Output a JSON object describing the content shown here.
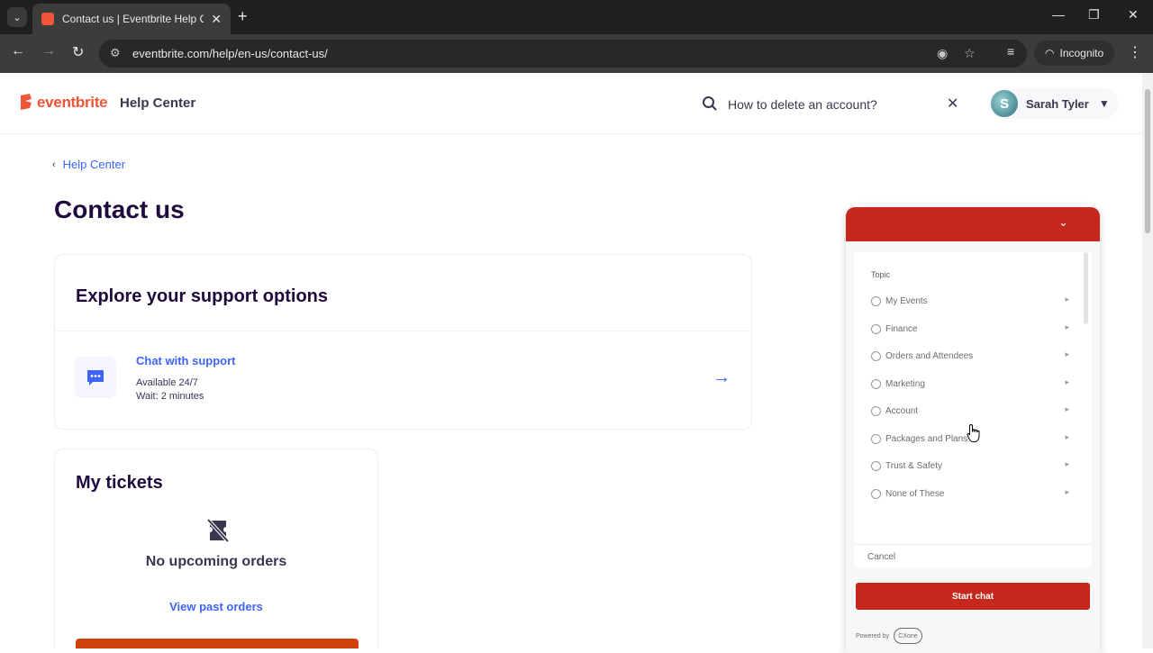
{
  "browser": {
    "tab_title": "Contact us | Eventbrite Help Ce",
    "url": "eventbrite.com/help/en-us/contact-us/",
    "incognito_label": "Incognito"
  },
  "header": {
    "logo_text": "eventbrite",
    "section_title": "Help Center",
    "search_value": "How to delete an account?",
    "user_name": "Sarah Tyler",
    "avatar_initial": "S"
  },
  "breadcrumb": {
    "label": "Help Center"
  },
  "page_title": "Contact us",
  "support": {
    "title": "Explore your support options",
    "chat_link": "Chat with support",
    "availability": "Available 24/7",
    "wait": "Wait: 2 minutes"
  },
  "tickets": {
    "title": "My tickets",
    "empty_text": "No upcoming orders",
    "view_past": "View past orders"
  },
  "chat_widget": {
    "topic_label": "Topic",
    "topics": [
      "My Events",
      "Finance",
      "Orders and Attendees",
      "Marketing",
      "Account",
      "Packages and Plans",
      "Trust & Safety",
      "None of These"
    ],
    "cancel_label": "Cancel",
    "start_chat_label": "Start chat",
    "powered_by": "Powered by",
    "brand_text": "CXone"
  },
  "colors": {
    "brand_orange": "#f05537",
    "link_blue": "#3d64ff",
    "widget_red": "#c5281c",
    "title_navy": "#1e0a3c"
  }
}
